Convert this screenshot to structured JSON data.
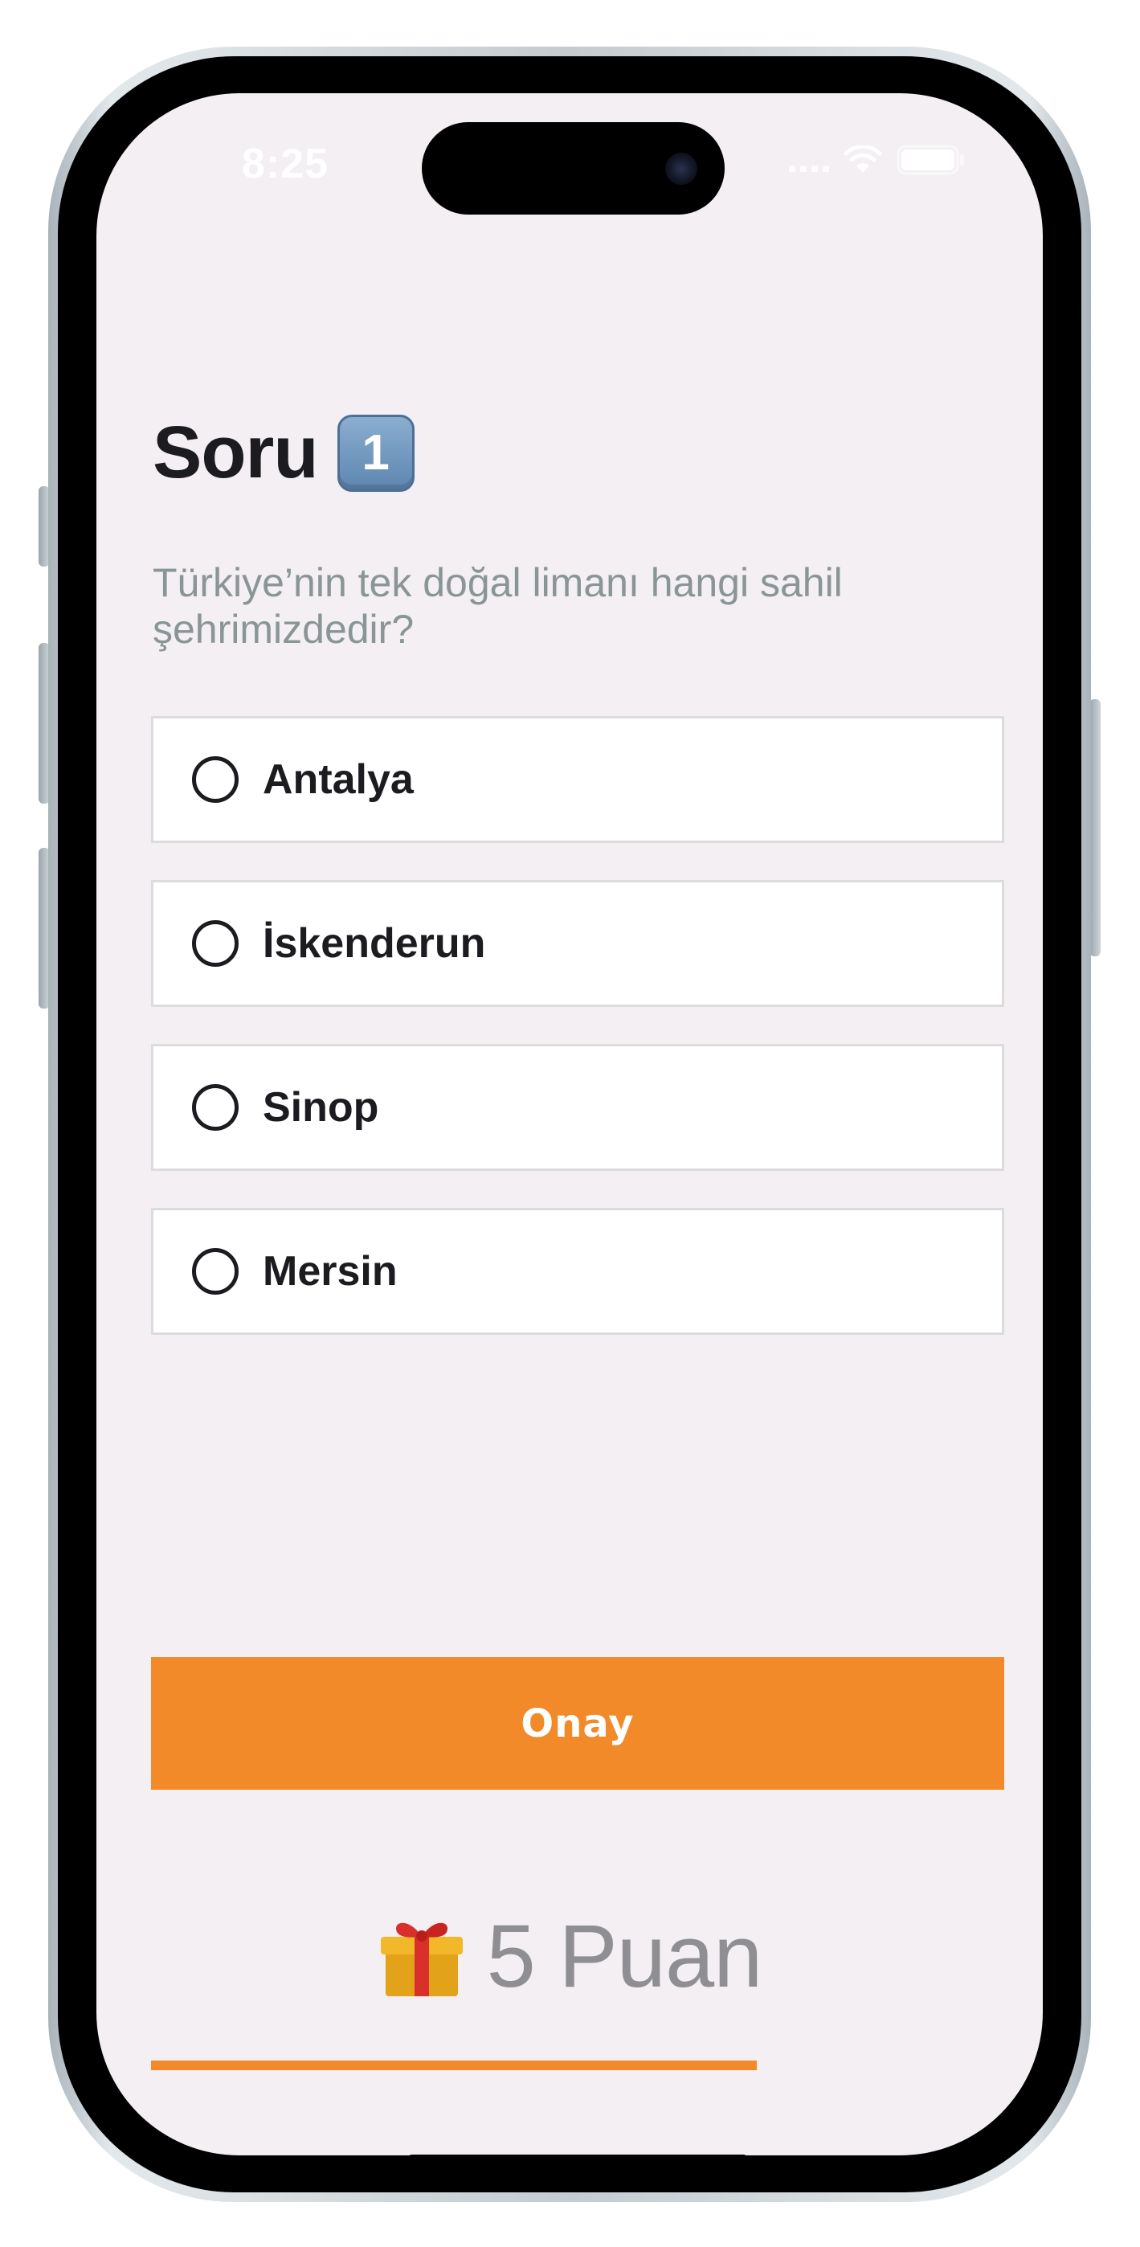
{
  "status_bar": {
    "time": "8:25"
  },
  "quiz": {
    "title": "Soru",
    "question_number": "1",
    "question": "Türkiye’nin tek doğal limanı hangi sahil şehrimizdedir?",
    "options": [
      {
        "label": "Antalya",
        "selected": false
      },
      {
        "label": "İskenderun",
        "selected": false
      },
      {
        "label": "Sinop",
        "selected": false
      },
      {
        "label": "Mersin",
        "selected": false
      }
    ],
    "confirm_label": "Onay",
    "points_label": "5 Puan",
    "progress_fraction": 0.71
  },
  "colors": {
    "accent": "#f28a29",
    "background": "#f3eff3",
    "question_text": "#8a9596",
    "points_text": "#8e8e93"
  },
  "icons": {
    "question_number_badge": "keycap-digit-icon",
    "reward": "gift-icon",
    "wifi": "wifi-icon",
    "battery": "battery-icon"
  }
}
